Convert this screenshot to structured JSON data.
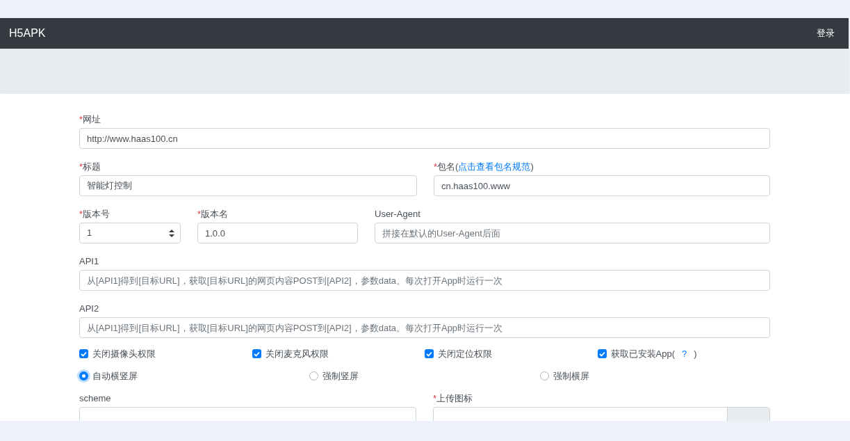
{
  "navbar": {
    "brand": "H5APK",
    "login": "登录"
  },
  "rows": [
    {
      "fields": [
        {
          "kind": "text",
          "marker": "*",
          "label": "网址",
          "value": "http://www.haas100.cn"
        }
      ]
    },
    {
      "fields": [
        {
          "kind": "text",
          "marker": "*",
          "label": "标题",
          "value": "智能灯控制"
        },
        {
          "kind": "text",
          "marker": "*",
          "label": "包名(",
          "link": "点击查看包名规范",
          "label_end": ")",
          "value": "cn.haas100.www"
        }
      ]
    },
    {
      "fields": [
        {
          "kind": "select",
          "marker": "*",
          "label": "版本号",
          "value": "1"
        },
        {
          "kind": "text",
          "marker": "*",
          "label": "版本名",
          "value": "1.0.0"
        },
        {
          "kind": "text",
          "label": "User-Agent",
          "placeholder": "拼接在默认的User-Agent后面"
        }
      ]
    },
    {
      "fields": [
        {
          "kind": "text",
          "label": "API1",
          "placeholder": "从[API1]得到[目标URL]，获取[目标URL]的网页内容POST到[API2]，参数data。每次打开App时运行一次"
        }
      ]
    },
    {
      "fields": [
        {
          "kind": "text",
          "label": "API2",
          "placeholder": "从[API1]得到[目标URL]，获取[目标URL]的网页内容POST到[API2]，参数data。每次打开App时运行一次"
        }
      ]
    }
  ],
  "checkboxes": [
    {
      "label": "关闭摄像头权限",
      "checked": true
    },
    {
      "label": "关闭麦克风权限",
      "checked": true
    },
    {
      "label": "关闭定位权限",
      "checked": true
    },
    {
      "label": "获取已安装App(",
      "help": "?",
      "label_end": ")",
      "checked": true
    }
  ],
  "orientation": [
    {
      "label": "自动横竖屏",
      "selected": true
    },
    {
      "label": "强制竖屏",
      "selected": false
    },
    {
      "label": "强制横屏",
      "selected": false
    }
  ],
  "bottom_fields": [
    {
      "kind": "text",
      "label": "scheme"
    },
    {
      "kind": "file",
      "marker": "*",
      "label": "上传图标"
    }
  ]
}
